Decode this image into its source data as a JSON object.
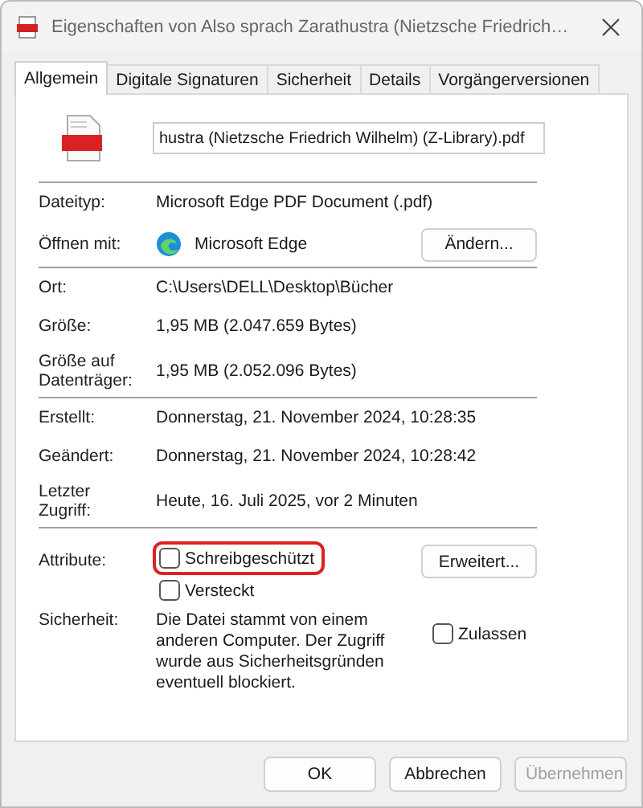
{
  "window": {
    "title": "Eigenschaften von Also sprach Zarathustra (Nietzsche Friedrich…"
  },
  "tabs": [
    {
      "label": "Allgemein",
      "selected": true
    },
    {
      "label": "Digitale Signaturen",
      "selected": false
    },
    {
      "label": "Sicherheit",
      "selected": false
    },
    {
      "label": "Details",
      "selected": false
    },
    {
      "label": "Vorgängerversionen",
      "selected": false
    }
  ],
  "file_name": {
    "value": "hustra (Nietzsche Friedrich Wilhelm) (Z-Library).pdf"
  },
  "file_type": {
    "label": "Dateityp:",
    "value": "Microsoft Edge PDF Document (.pdf)"
  },
  "open_with": {
    "label": "Öffnen mit:",
    "app": "Microsoft Edge",
    "button": "Ändern..."
  },
  "location": {
    "label": "Ort:",
    "value": "C:\\Users\\DELL\\Desktop\\Bücher"
  },
  "size": {
    "label": "Größe:",
    "value": "1,95 MB (2.047.659 Bytes)"
  },
  "size_on_disk": {
    "label": "Größe auf Datenträger:",
    "value": "1,95 MB (2.052.096 Bytes)"
  },
  "created": {
    "label": "Erstellt:",
    "value": "Donnerstag, 21. November 2024, 10:28:35"
  },
  "modified": {
    "label": "Geändert:",
    "value": "Donnerstag, 21. November 2024, 10:28:42"
  },
  "accessed": {
    "label": "Letzter Zugriff:",
    "value": "Heute, 16. Juli 2025, vor 2 Minuten"
  },
  "attributes": {
    "label": "Attribute:",
    "button": "Erweitert...",
    "items": [
      {
        "label": "Schreibgeschützt",
        "checked": false,
        "highlighted": true
      },
      {
        "label": "Versteckt",
        "checked": false,
        "highlighted": false
      }
    ]
  },
  "security": {
    "label": "Sicherheit:",
    "text": "Die Datei stammt von einem anderen Computer. Der Zugriff wurde aus Sicherheitsgründen eventuell blockiert.",
    "checkbox": {
      "label": "Zulassen",
      "checked": false
    }
  },
  "buttons": [
    {
      "label": "OK",
      "disabled": false
    },
    {
      "label": "Abbrechen",
      "disabled": false
    },
    {
      "label": "Übernehmen",
      "disabled": true
    }
  ]
}
